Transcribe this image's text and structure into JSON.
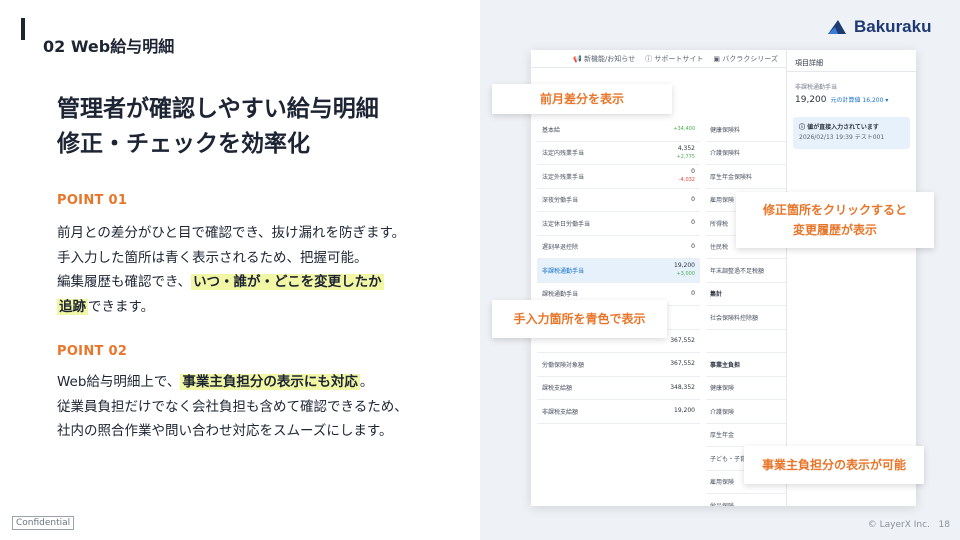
{
  "section": {
    "title": "02 Web給与明細"
  },
  "headline": {
    "line1": "管理者が確認しやすい給与明細",
    "line2": "修正・チェックを効率化"
  },
  "point1": {
    "label": "POINT 01",
    "line1": "前月との差分がひと目で確認でき、抜け漏れを防ぎます。",
    "line2": "手入力した箇所は青く表示されるため、把握可能。",
    "line3_pre": "編集履歴も確認でき、",
    "line3_hl": "いつ・誰が・どこを変更したか",
    "line4_hl": "追跡",
    "line4_post": "できます。"
  },
  "point2": {
    "label": "POINT 02",
    "line1_pre": "Web給与明細上で、",
    "line1_hl": "事業主負担分の表示にも対応",
    "line1_post": "。",
    "line2": "従業員負担だけでなく会社負担も含めて確認できるため、",
    "line3": "社内の照合作業や問い合わせ対応をスムーズにします。"
  },
  "brand": {
    "name": "Bakuraku",
    "color": "#1d3a73"
  },
  "footer": {
    "confidential": "Confidential",
    "copyright": "© LayerX Inc.",
    "page": "18"
  },
  "screenshot": {
    "topbar": [
      "新機能/お知らせ",
      "サポートサイト",
      "バクラクシリーズ"
    ],
    "left_rows": [
      {
        "label": "基本給",
        "value": "",
        "diff": "+34,400"
      },
      {
        "label": "法定内残業手当",
        "value": "4,352",
        "diff": "+2,775"
      },
      {
        "label": "法定外残業手当",
        "value": "0",
        "diff": "-4,032"
      },
      {
        "label": "深夜労働手当",
        "value": "0",
        "diff": ""
      },
      {
        "label": "法定休日労働手当",
        "value": "0",
        "diff": ""
      },
      {
        "label": "遅刻早退控除",
        "value": "0",
        "diff": ""
      },
      {
        "label": "非課税通勤手当",
        "value": "19,200",
        "diff": "+3,000"
      },
      {
        "label": "課税通勤手当",
        "value": "0",
        "diff": ""
      },
      {
        "label": "",
        "value": "",
        "diff": ""
      },
      {
        "label": "",
        "value": "367,552",
        "diff": ""
      },
      {
        "label": "労働保険対象額",
        "value": "367,552",
        "diff": ""
      },
      {
        "label": "課税支給額",
        "value": "348,352",
        "diff": ""
      },
      {
        "label": "非課税支給額",
        "value": "19,200",
        "diff": ""
      }
    ],
    "mid_rows": [
      "健康保険料",
      "介護保険料",
      "厚生年金保険料",
      "雇用保険",
      "所得税",
      "住民税",
      "年末調整過不足税額",
      "集計",
      "社会保険料控除額",
      "",
      "事業主負担",
      "健康保険",
      "介護保険",
      "厚生年金",
      "子ども・子育て拠出金",
      "雇用保険",
      "労災保険",
      "一般拠出金"
    ],
    "side": {
      "title": "項目詳細",
      "sub": "非課税通勤手当",
      "value": "19,200",
      "orig": "元の計算値 16,200",
      "notice_title": "値が直接入力されています",
      "notice_meta": "2026/02/13 19:39  テスト001"
    }
  },
  "callouts": {
    "diff": "前月差分を表示",
    "history_line1": "修正箇所をクリックすると",
    "history_line2": "変更履歴が表示",
    "manual": "手入力箇所を青色で表示",
    "employer": "事業主負担分の表示が可能"
  }
}
